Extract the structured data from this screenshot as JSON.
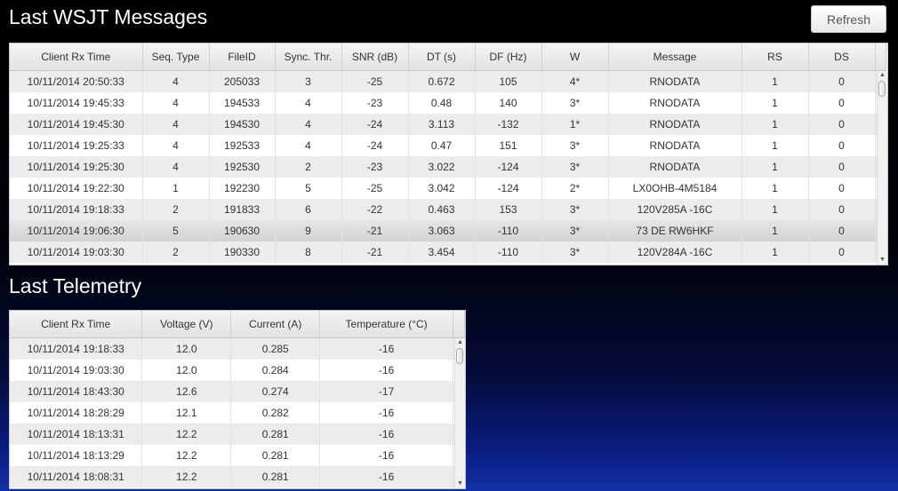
{
  "wsjt": {
    "title": "Last WSJT Messages",
    "refresh_label": "Refresh",
    "columns": [
      "Client Rx Time",
      "Seq. Type",
      "FileID",
      "Sync. Thr.",
      "SNR (dB)",
      "DT (s)",
      "DF (Hz)",
      "W",
      "Message",
      "RS",
      "DS"
    ],
    "rows": [
      [
        "10/11/2014 20:50:33",
        "4",
        "205033",
        "3",
        "-25",
        "0.672",
        "105",
        "4*",
        "RNODATA",
        "1",
        "0"
      ],
      [
        "10/11/2014 19:45:33",
        "4",
        "194533",
        "4",
        "-23",
        "0.48",
        "140",
        "3*",
        "RNODATA",
        "1",
        "0"
      ],
      [
        "10/11/2014 19:45:30",
        "4",
        "194530",
        "4",
        "-24",
        "3.113",
        "-132",
        "1*",
        "RNODATA",
        "1",
        "0"
      ],
      [
        "10/11/2014 19:25:33",
        "4",
        "192533",
        "4",
        "-24",
        "0.47",
        "151",
        "3*",
        "RNODATA",
        "1",
        "0"
      ],
      [
        "10/11/2014 19:25:30",
        "4",
        "192530",
        "2",
        "-23",
        "3.022",
        "-124",
        "3*",
        "RNODATA",
        "1",
        "0"
      ],
      [
        "10/11/2014 19:22:30",
        "1",
        "192230",
        "5",
        "-25",
        "3.042",
        "-124",
        "2*",
        "LX0OHB-4M5184",
        "1",
        "0"
      ],
      [
        "10/11/2014 19:18:33",
        "2",
        "191833",
        "6",
        "-22",
        "0.463",
        "153",
        "3*",
        "120V285A -16C",
        "1",
        "0"
      ],
      [
        "10/11/2014 19:06:30",
        "5",
        "190630",
        "9",
        "-21",
        "3.063",
        "-110",
        "3*",
        "73 DE RW6HKF",
        "1",
        "0"
      ],
      [
        "10/11/2014 19:03:30",
        "2",
        "190330",
        "8",
        "-21",
        "3.454",
        "-110",
        "3*",
        "120V284A -16C",
        "1",
        "0"
      ]
    ],
    "highlighted_row": 7
  },
  "telemetry": {
    "title": "Last Telemetry",
    "columns": [
      "Client Rx Time",
      "Voltage (V)",
      "Current (A)",
      "Temperature (°C)"
    ],
    "rows": [
      [
        "10/11/2014 19:18:33",
        "12.0",
        "0.285",
        "-16"
      ],
      [
        "10/11/2014 19:03:30",
        "12.0",
        "0.284",
        "-16"
      ],
      [
        "10/11/2014 18:43:30",
        "12.6",
        "0.274",
        "-17"
      ],
      [
        "10/11/2014 18:28:29",
        "12.1",
        "0.282",
        "-16"
      ],
      [
        "10/11/2014 18:13:31",
        "12.2",
        "0.281",
        "-16"
      ],
      [
        "10/11/2014 18:13:29",
        "12.2",
        "0.281",
        "-16"
      ],
      [
        "10/11/2014 18:08:31",
        "12.2",
        "0.281",
        "-16"
      ]
    ]
  },
  "icons": {
    "scroll_up": "scroll-up-arrow-icon",
    "scroll_down": "scroll-down-arrow-icon"
  },
  "colors": {
    "title_text": "#ffffff",
    "odd_row": "#ececec",
    "even_row": "#ffffff",
    "header_bg": "#e8e8e8"
  }
}
